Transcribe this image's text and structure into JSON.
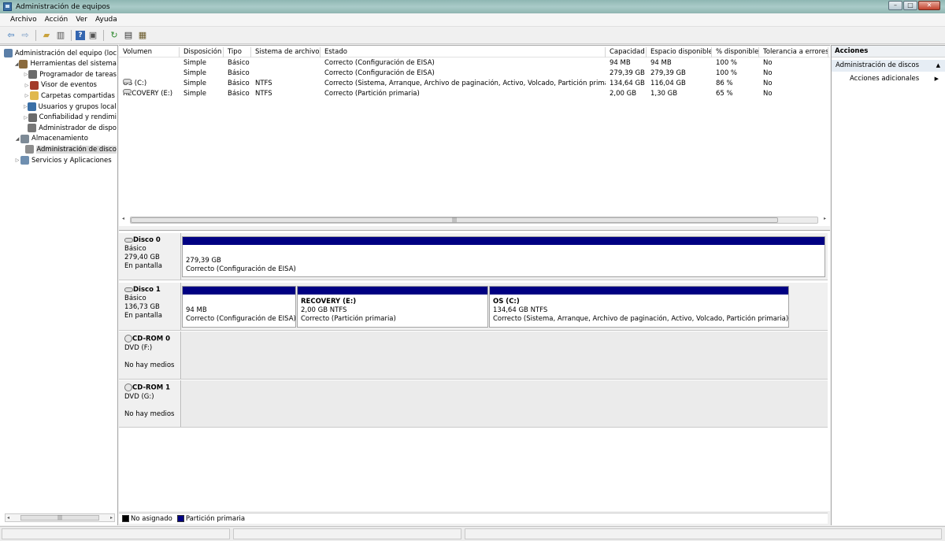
{
  "window": {
    "title": "Administración de equipos"
  },
  "menu": [
    "Archivo",
    "Acción",
    "Ver",
    "Ayuda"
  ],
  "toolbar": [
    "back-icon",
    "forward-icon",
    "up-folder-icon",
    "show-tree-icon",
    "help-icon",
    "view-icon",
    "refresh-icon",
    "properties-icon",
    "export-icon"
  ],
  "tree": [
    {
      "label": "Administración del equipo (loc",
      "level": 0,
      "arrow": "",
      "icon_color": "#5b7fa8"
    },
    {
      "label": "Herramientas del sistema",
      "level": 1,
      "arrow": "◢",
      "icon_color": "#8a6a3c"
    },
    {
      "label": "Programador de tareas",
      "level": 2,
      "arrow": "▷",
      "icon_color": "#6b6b6b"
    },
    {
      "label": "Visor de eventos",
      "level": 2,
      "arrow": "▷",
      "icon_color": "#a33b2a"
    },
    {
      "label": "Carpetas compartidas",
      "level": 2,
      "arrow": "▷",
      "icon_color": "#e0b84c"
    },
    {
      "label": "Usuarios y grupos locale",
      "level": 2,
      "arrow": "▷",
      "icon_color": "#3a6fa6"
    },
    {
      "label": "Confiabilidad y rendimi",
      "level": 2,
      "arrow": "▷",
      "icon_color": "#6a6a6a"
    },
    {
      "label": "Administrador de dispo",
      "level": 2,
      "arrow": "",
      "icon_color": "#777777"
    },
    {
      "label": "Almacenamiento",
      "level": 1,
      "arrow": "◢",
      "icon_color": "#7d8a96"
    },
    {
      "label": "Administración de disco",
      "level": 2,
      "arrow": "",
      "icon_color": "#8e8e8e",
      "selected": true
    },
    {
      "label": "Servicios y Aplicaciones",
      "level": 1,
      "arrow": "▷",
      "icon_color": "#6f8fb0"
    }
  ],
  "volumes": {
    "headers": [
      "Volumen",
      "Disposición",
      "Tipo",
      "Sistema de archivos",
      "Estado",
      "Capacidad",
      "Espacio disponible",
      "% disponible",
      "Tolerancia a errores"
    ],
    "rows": [
      [
        "",
        "Simple",
        "Básico",
        "",
        "Correcto (Configuración de EISA)",
        "94 MB",
        "94 MB",
        "100 %",
        "No"
      ],
      [
        "",
        "Simple",
        "Básico",
        "",
        "Correcto (Configuración de EISA)",
        "279,39 GB",
        "279,39 GB",
        "100 %",
        "No"
      ],
      [
        "OS (C:)",
        "Simple",
        "Básico",
        "NTFS",
        "Correcto (Sistema, Arranque, Archivo de paginación, Activo, Volcado, Partición primaria)",
        "134,64 GB",
        "116,04 GB",
        "86 %",
        "No"
      ],
      [
        "RECOVERY (E:)",
        "Simple",
        "Básico",
        "NTFS",
        "Correcto (Partición primaria)",
        "2,00 GB",
        "1,30 GB",
        "65 %",
        "No"
      ]
    ]
  },
  "disks": [
    {
      "name": "Disco 0",
      "type": "Básico",
      "size": "279,40 GB",
      "state": "En pantalla",
      "partitions": [
        {
          "title": "",
          "size": "279,39 GB",
          "status": "Correcto (Configuración de EISA)"
        }
      ]
    },
    {
      "name": "Disco 1",
      "type": "Básico",
      "size": "136,73 GB",
      "state": "En pantalla",
      "partitions": [
        {
          "title": "",
          "size": "94 MB",
          "status": "Correcto (Configuración de EISA)"
        },
        {
          "title": "RECOVERY  (E:)",
          "size": "2,00 GB NTFS",
          "status": "Correcto (Partición primaria)"
        },
        {
          "title": "OS  (C:)",
          "size": "134,64 GB NTFS",
          "status": "Correcto (Sistema, Arranque, Archivo de paginación, Activo, Volcado, Partición primaria)"
        }
      ]
    },
    {
      "name": "CD-ROM 0",
      "type": "DVD (F:)",
      "size": "",
      "state": "No hay medios"
    },
    {
      "name": "CD-ROM 1",
      "type": "DVD (G:)",
      "size": "",
      "state": "No hay medios"
    }
  ],
  "legend": [
    {
      "label": "No asignado",
      "color": "#000000"
    },
    {
      "label": "Partición primaria",
      "color": "#000082"
    }
  ],
  "actions": {
    "header": "Acciones",
    "section": "Administración de discos",
    "items": [
      "Acciones adicionales"
    ]
  }
}
